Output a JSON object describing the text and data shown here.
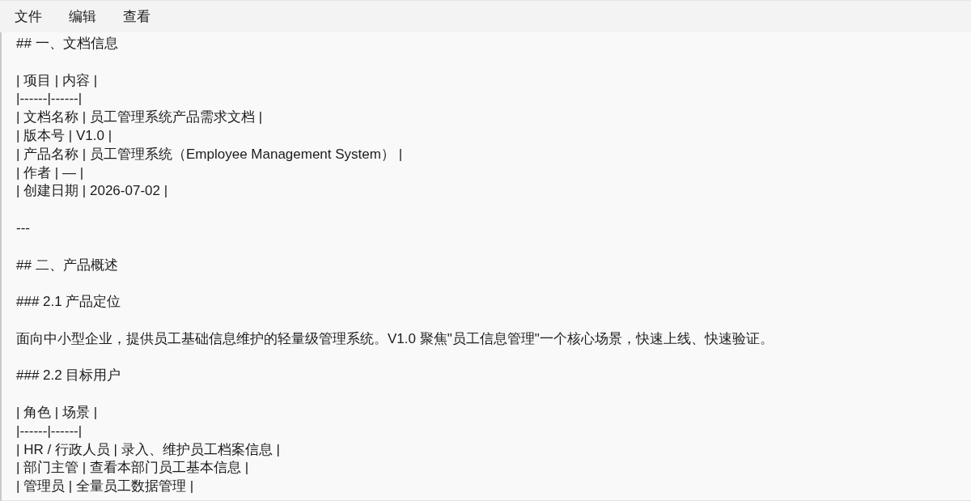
{
  "menu": [
    "文件",
    "编辑",
    "查看"
  ],
  "editor": {
    "blocks": [
      {
        "lines": [
          "## 一、文档信息"
        ]
      },
      {
        "lines": [
          "| 项目 | 内容 |",
          "|------|------|",
          "| 文档名称 | 员工管理系统产品需求文档 |",
          "| 版本号 | V1.0 |",
          "| 产品名称 | 员工管理系统（Employee Management System） |",
          "| 作者 | — |",
          "| 创建日期 | 2026-07-02 |"
        ]
      },
      {
        "lines": [
          "---"
        ]
      },
      {
        "lines": [
          "## 二、产品概述"
        ]
      },
      {
        "lines": [
          "### 2.1 产品定位"
        ]
      },
      {
        "lines": [
          "面向中小型企业，提供员工基础信息维护的轻量级管理系统。V1.0 聚焦\"员工信息管理\"一个核心场景，快速上线、快速验证。"
        ]
      },
      {
        "lines": [
          "### 2.2 目标用户"
        ]
      },
      {
        "lines": [
          "| 角色 | 场景 |",
          "|------|------|",
          "| HR / 行政人员 | 录入、维护员工档案信息 |",
          "| 部门主管 | 查看本部门员工基本信息 |",
          "| 管理员 | 全量员工数据管理 |"
        ]
      }
    ]
  }
}
